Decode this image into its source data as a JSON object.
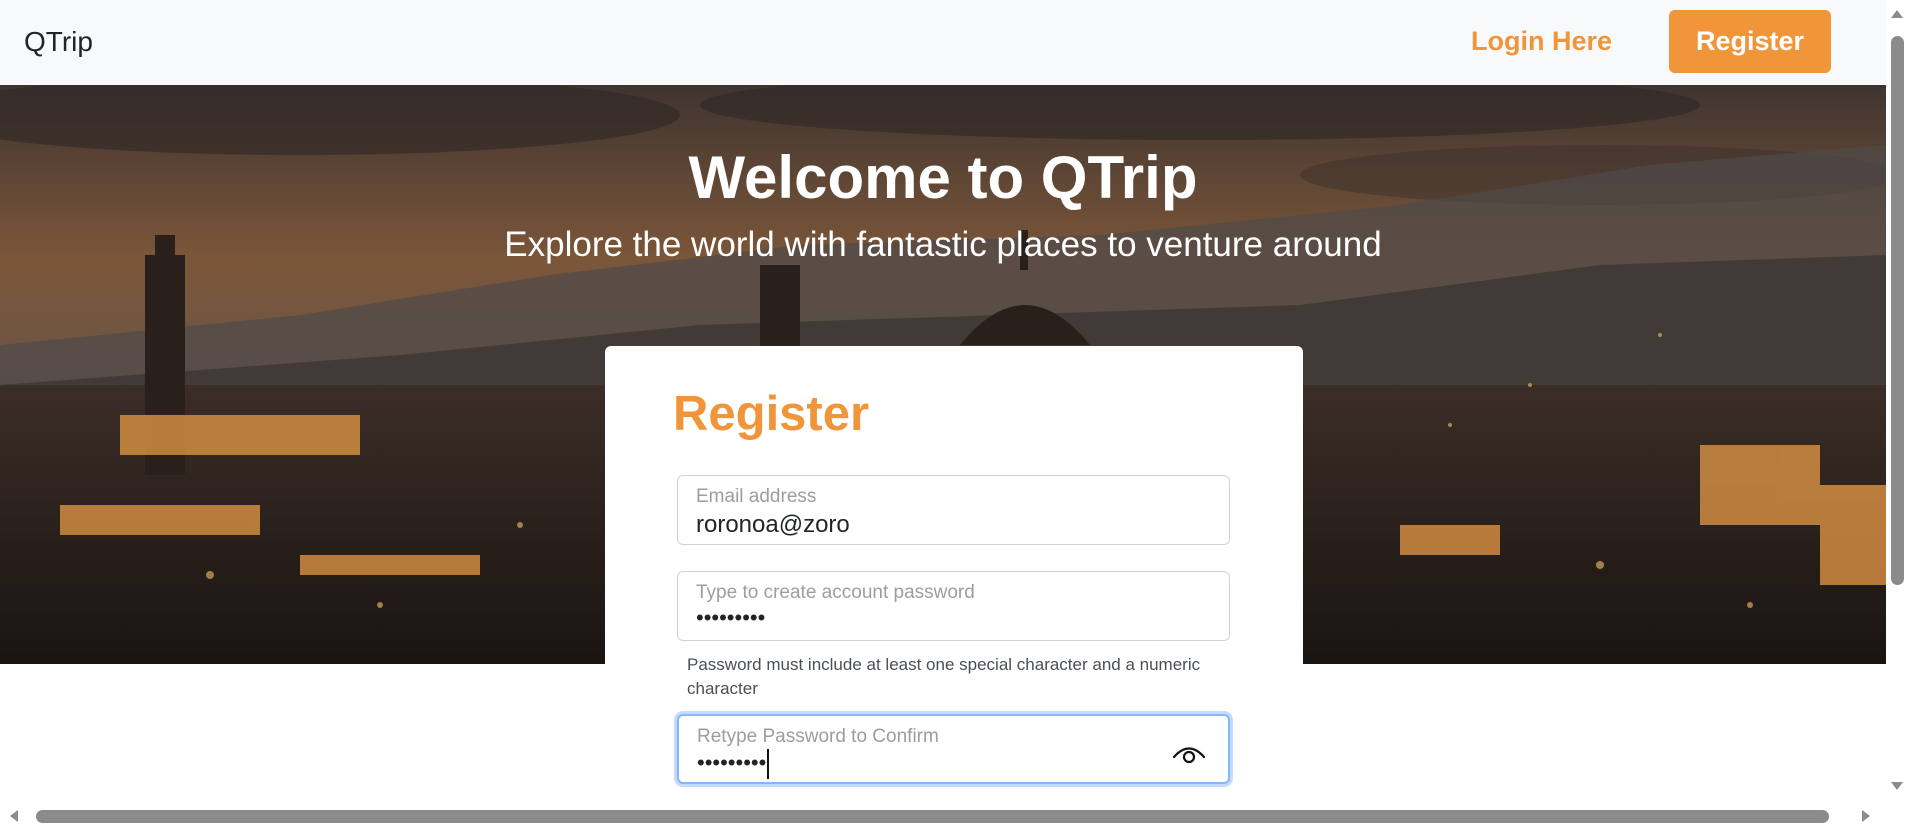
{
  "navbar": {
    "brand": "QTrip",
    "login_label": "Login Here",
    "register_label": "Register"
  },
  "hero": {
    "title": "Welcome to QTrip",
    "subtitle": "Explore the world with fantastic places to venture around"
  },
  "register_form": {
    "title": "Register",
    "email": {
      "label": "Email address",
      "value": "roronoa@zoro"
    },
    "password": {
      "label": "Type to create account password",
      "value": "•••••••••"
    },
    "password_help": "Password must include at least one special character and a numeric character",
    "confirm_password": {
      "label": "Retype Password to Confirm",
      "value": "•••••••••"
    }
  },
  "colors": {
    "accent": "#f0953a",
    "navbar_bg": "#f8f9fa",
    "focus_border": "#86b7fe"
  },
  "icons": {
    "show_password": "eye-icon"
  }
}
